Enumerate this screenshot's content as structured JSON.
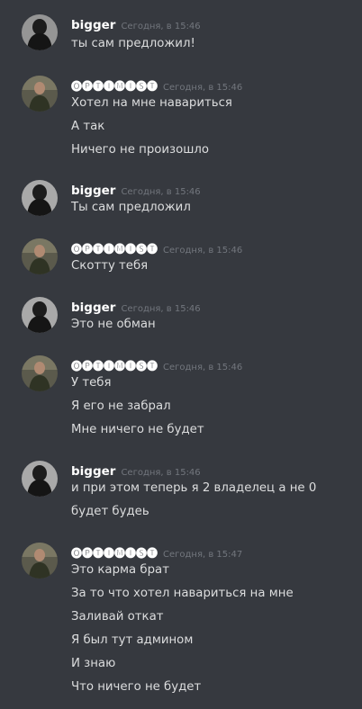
{
  "users": {
    "bigger": {
      "name": "bigger",
      "avatar_icon": "dark-hooded-figure-avatar"
    },
    "optimist": {
      "name": "🅞🅟🅣🅘🅜🅘🅢🅣",
      "avatar_icon": "man-standing-avatar"
    }
  },
  "messages": [
    {
      "author": "bigger",
      "timestamp": "Сегодня, в 15:46",
      "lines": [
        "ты сам предложил!"
      ]
    },
    {
      "author": "optimist",
      "timestamp": "Сегодня, в 15:46",
      "lines": [
        "Хотел на мне навариться",
        "А так",
        "Ничего не произошло"
      ]
    },
    {
      "author": "bigger",
      "timestamp": "Сегодня, в 15:46",
      "lines": [
        "Ты сам предложил"
      ]
    },
    {
      "author": "optimist",
      "timestamp": "Сегодня, в 15:46",
      "lines": [
        "Скотту тебя"
      ]
    },
    {
      "author": "bigger",
      "timestamp": "Сегодня, в 15:46",
      "lines": [
        "Это не обман"
      ]
    },
    {
      "author": "optimist",
      "timestamp": "Сегодня, в 15:46",
      "lines": [
        "У тебя",
        "Я его не забрал",
        "Мне ничего не будет"
      ]
    },
    {
      "author": "bigger",
      "timestamp": "Сегодня, в 15:46",
      "lines": [
        "и при этом теперь я 2 владелец а не 0",
        "будет будеь"
      ]
    },
    {
      "author": "optimist",
      "timestamp": "Сегодня, в 15:47",
      "lines": [
        "Это карма брат",
        "За то что хотел навариться на мне",
        "Заливай откат",
        "Я был тут админом",
        "И знаю",
        "Что ничего не будет"
      ]
    }
  ],
  "colors": {
    "background": "#36393f",
    "username": "#ffffff",
    "timestamp": "#72767d",
    "text": "#dcddde"
  }
}
